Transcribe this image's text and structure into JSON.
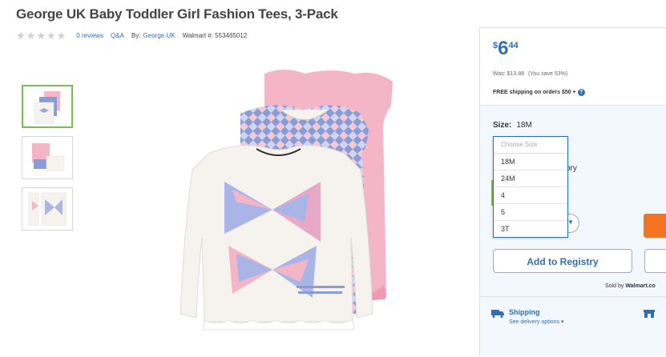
{
  "product": {
    "title": "George UK Baby Toddler Girl Fashion Tees, 3-Pack",
    "reviews": "0 reviews",
    "qa": "Q&A",
    "by_label": "By:",
    "brand": "George UK",
    "item_number": "Walmart #: 553465012"
  },
  "pricing": {
    "currency": "$",
    "dollars": "6",
    "cents": "44",
    "was": "Was: $13.88",
    "save": "(You save 53%)",
    "free_shipping": "FREE shipping on orders $50 +",
    "help": "?"
  },
  "size": {
    "label": "Size:",
    "selected": "18M",
    "placeholder": "Choose Size",
    "options": [
      "18M",
      "24M",
      "4",
      "5",
      "3T"
    ]
  },
  "partial_text": "ory",
  "buttons": {
    "registry": "Add to Registry"
  },
  "seller": {
    "prefix": "Sold by",
    "name": "Walmart.co"
  },
  "shipping": {
    "title": "Shipping",
    "link": "See delivery options",
    "chevron": "▾"
  },
  "icons": {
    "star": "★",
    "qty_chevron": "▼"
  },
  "colors": {
    "accent": "#2f6fb5",
    "cart": "#f47321",
    "selected_thumb": "#7bbf4b",
    "tee_pink": "#f4b6c6",
    "tee_white": "#f6f3ee",
    "tee_blue": "#8a9bd6"
  }
}
